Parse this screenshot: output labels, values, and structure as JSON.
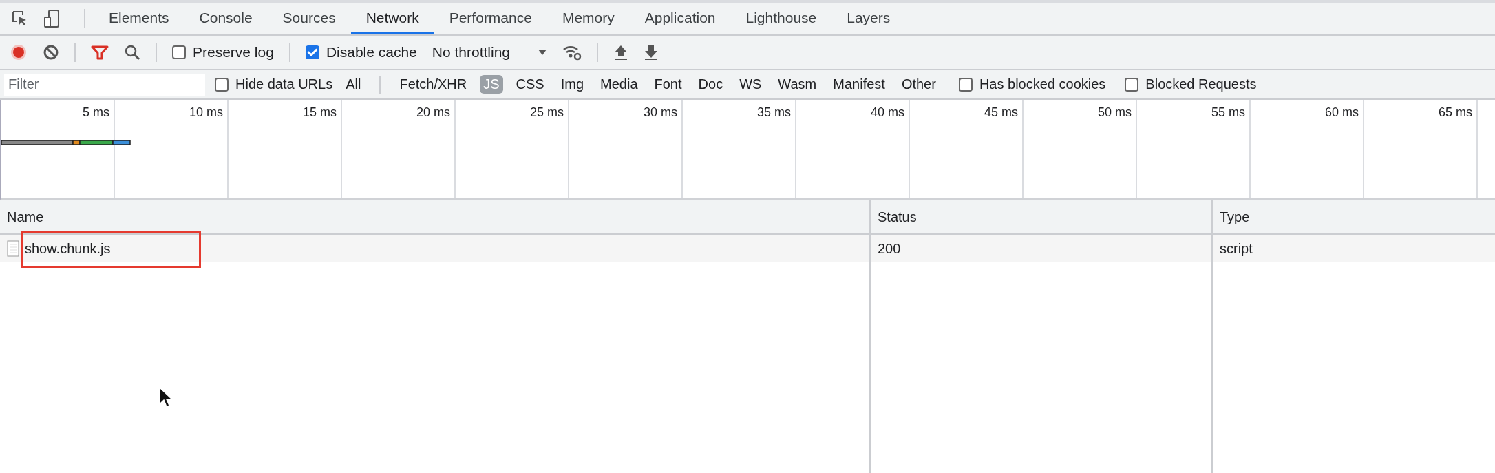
{
  "tabs": [
    {
      "label": "Elements",
      "selected": false
    },
    {
      "label": "Console",
      "selected": false
    },
    {
      "label": "Sources",
      "selected": false
    },
    {
      "label": "Network",
      "selected": true
    },
    {
      "label": "Performance",
      "selected": false
    },
    {
      "label": "Memory",
      "selected": false
    },
    {
      "label": "Application",
      "selected": false
    },
    {
      "label": "Lighthouse",
      "selected": false
    },
    {
      "label": "Layers",
      "selected": false
    }
  ],
  "toolbar": {
    "recording": true,
    "preserve_log": {
      "label": "Preserve log",
      "checked": false
    },
    "disable_cache": {
      "label": "Disable cache",
      "checked": true
    },
    "throttling": "No throttling"
  },
  "filter_bar": {
    "placeholder": "Filter",
    "hide_data_urls": {
      "label": "Hide data URLs",
      "checked": false
    },
    "types": [
      {
        "label": "All",
        "selected": false
      },
      {
        "label": "Fetch/XHR",
        "selected": false
      },
      {
        "label": "JS",
        "selected": true
      },
      {
        "label": "CSS",
        "selected": false
      },
      {
        "label": "Img",
        "selected": false
      },
      {
        "label": "Media",
        "selected": false
      },
      {
        "label": "Font",
        "selected": false
      },
      {
        "label": "Doc",
        "selected": false
      },
      {
        "label": "WS",
        "selected": false
      },
      {
        "label": "Wasm",
        "selected": false
      },
      {
        "label": "Manifest",
        "selected": false
      },
      {
        "label": "Other",
        "selected": false
      }
    ],
    "options": [
      {
        "label": "Has blocked cookies",
        "checked": false
      },
      {
        "label": "Blocked Requests",
        "checked": false
      }
    ]
  },
  "overview": {
    "ticks": [
      "5 ms",
      "10 ms",
      "15 ms",
      "20 ms",
      "25 ms",
      "30 ms",
      "35 ms",
      "40 ms",
      "45 ms",
      "50 ms",
      "55 ms",
      "60 ms",
      "65 ms"
    ]
  },
  "table": {
    "columns": [
      "Name",
      "Status",
      "Type"
    ],
    "rows": [
      {
        "name": "show.chunk.js",
        "status": "200",
        "type": "script",
        "highlighted": true
      }
    ]
  }
}
